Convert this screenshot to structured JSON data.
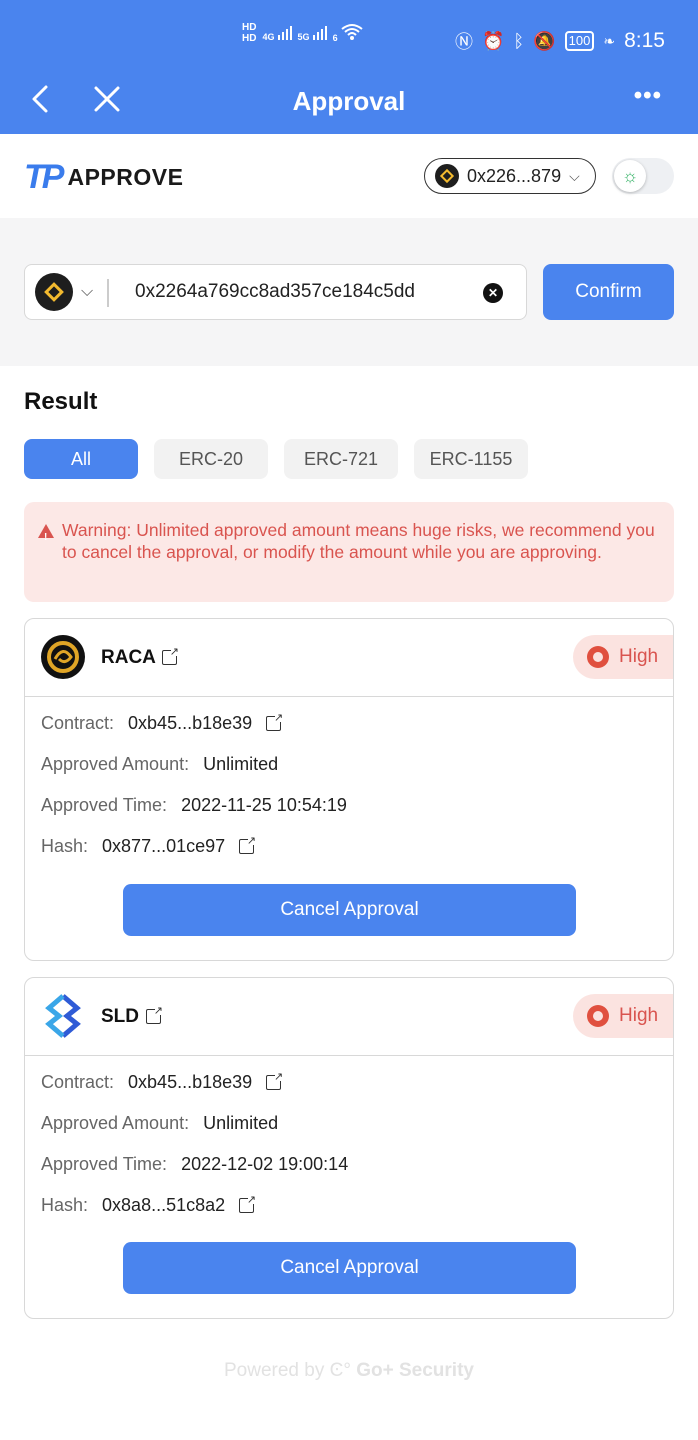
{
  "status_bar": {
    "left_labels": [
      "HD",
      "HD",
      "4G",
      "5G",
      "6"
    ],
    "battery": "100",
    "time": "8:15"
  },
  "nav": {
    "title": "Approval",
    "more": "•••"
  },
  "brand": {
    "logo_mark": "TP",
    "logo_word": "APPROVE",
    "wallet_address": "0x226...879"
  },
  "search": {
    "address_value": "0x2264a769cc8ad357ce184c5dd",
    "confirm_label": "Confirm"
  },
  "result": {
    "title": "Result",
    "tabs": [
      {
        "label": "All",
        "active": true
      },
      {
        "label": "ERC-20",
        "active": false
      },
      {
        "label": "ERC-721",
        "active": false
      },
      {
        "label": "ERC-1155",
        "active": false
      }
    ],
    "warning": "Warning: Unlimited approved amount means huge risks, we recommend you to cancel the approval, or modify the amount while you are approving."
  },
  "approvals": [
    {
      "token": "RACA",
      "risk": "High",
      "contract_label": "Contract:",
      "contract": "0xb45...b18e39",
      "amount_label": "Approved Amount:",
      "amount": "Unlimited",
      "time_label": "Approved Time:",
      "time": "2022-11-25 10:54:19",
      "hash_label": "Hash:",
      "hash": "0x877...01ce97",
      "cancel_label": "Cancel Approval"
    },
    {
      "token": "SLD",
      "risk": "High",
      "contract_label": "Contract:",
      "contract": "0xb45...b18e39",
      "amount_label": "Approved Amount:",
      "amount": "Unlimited",
      "time_label": "Approved Time:",
      "time": "2022-12-02 19:00:14",
      "hash_label": "Hash:",
      "hash": "0x8a8...51c8a2",
      "cancel_label": "Cancel Approval"
    }
  ],
  "footer": {
    "powered_by": "Powered by",
    "brand": "Go+ Security"
  },
  "colors": {
    "primary": "#4a84ee",
    "danger": "#d9544f",
    "warning_bg": "#fce8e6",
    "bnb_gold": "#f3ba2f"
  },
  "icons": [
    "back-arrow-icon",
    "close-icon",
    "more-icon",
    "bnb-icon",
    "chevron-down-icon",
    "sun-icon",
    "clear-icon",
    "warning-icon",
    "external-link-icon",
    "risk-icon",
    "raca-logo",
    "sld-logo"
  ]
}
